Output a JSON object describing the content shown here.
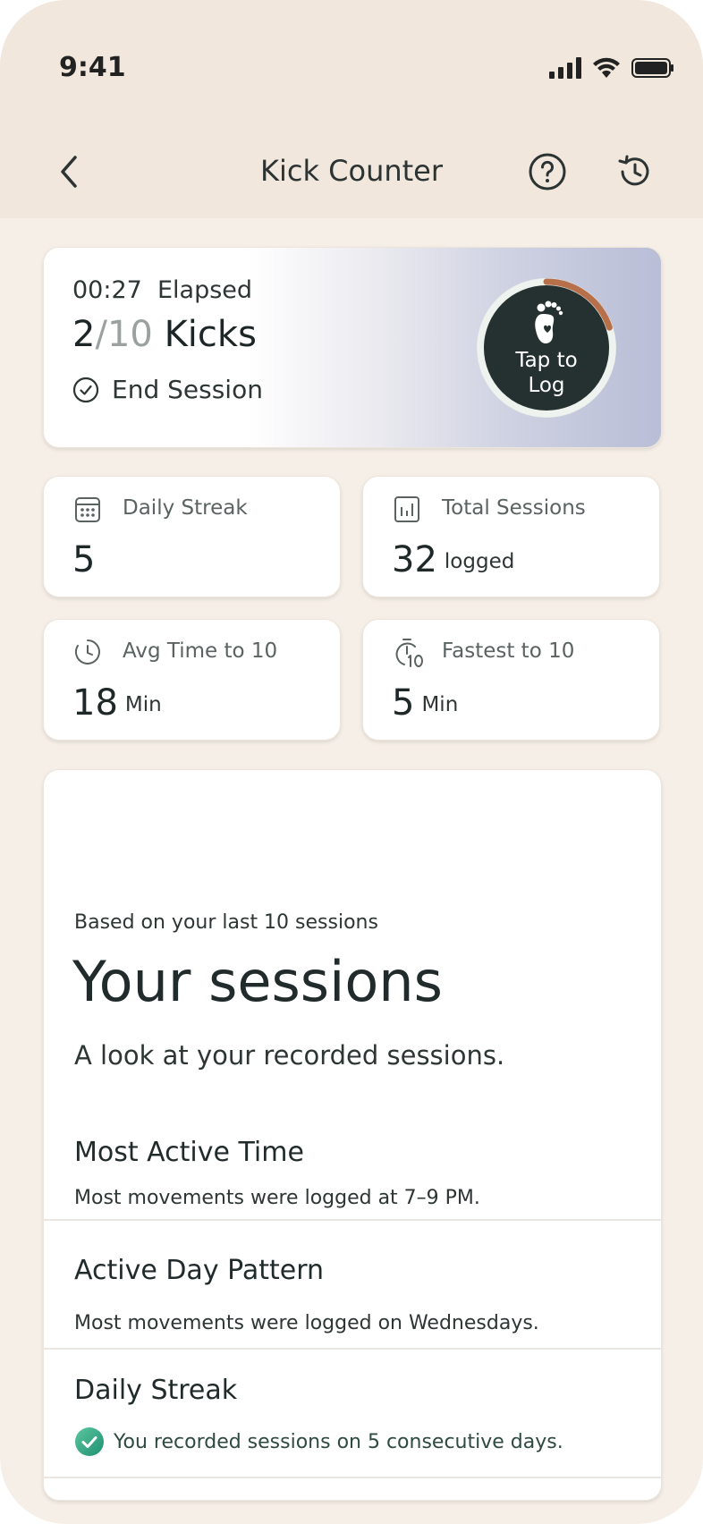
{
  "status": {
    "time": "9:41"
  },
  "nav": {
    "title": "Kick Counter"
  },
  "session": {
    "elapsed_time": "00:27",
    "elapsed_label": "Elapsed",
    "kicks_count": "2",
    "kicks_separator": "/",
    "kicks_goal": "10",
    "kicks_label": "Kicks",
    "end_label": "End Session",
    "tap_label_line1": "Tap to",
    "tap_label_line2": "Log",
    "progress": 0.2
  },
  "stats": [
    {
      "title": "Daily Streak",
      "value": "5",
      "unit": ""
    },
    {
      "title": "Total Sessions",
      "value": "32",
      "unit": "logged"
    },
    {
      "title": "Avg Time to 10",
      "value": "18",
      "unit": "Min"
    },
    {
      "title": "Fastest to 10",
      "value": "5",
      "unit": "Min"
    }
  ],
  "sessions": {
    "based_on": "Based on your last 10 sessions",
    "title": "Your sessions",
    "subtitle": "A look at your recorded sessions.",
    "insights": [
      {
        "title": "Most Active Time",
        "text": "Most movements were logged at 7–9 PM."
      },
      {
        "title": "Active Day Pattern",
        "text": "Most movements were logged on Wednesdays."
      },
      {
        "title": "Daily Streak",
        "text": "You recorded sessions on 5 consecutive days."
      }
    ]
  },
  "colors": {
    "background": "#f6efe7",
    "header": "#f1e7dc",
    "accent_dark": "#253130",
    "progress_ring": "#b8704a",
    "success": "#2a9d7b"
  }
}
